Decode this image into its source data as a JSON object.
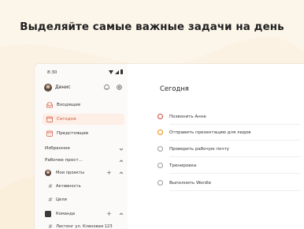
{
  "headline": "Выделяйте самые важные задачи на день",
  "status": {
    "time": "8:30"
  },
  "user": {
    "name": "Денис"
  },
  "nav": {
    "inbox": "Входящие",
    "today": "Сегодня",
    "upcoming": "Предстоящее"
  },
  "sections": {
    "favorites": "Избранное",
    "workspace": "Рабочее прост..."
  },
  "projects": {
    "my_projects": "Мои проекты",
    "activity": "Активность",
    "goals": "Цели",
    "team": "Команда",
    "list_partial": "Листинг ул. Кленовая 123"
  },
  "main": {
    "title": "Сегодня",
    "tasks": [
      {
        "label": "Позвонить Анне",
        "priority": "p1"
      },
      {
        "label": "Отправить презентацию для лидов",
        "priority": "p2"
      },
      {
        "label": "Проверить рабочую почту",
        "priority": "none"
      },
      {
        "label": "Тренировка",
        "priority": "none"
      },
      {
        "label": "Выполнить Wordle",
        "priority": "none"
      }
    ]
  },
  "colors": {
    "accent": "#d4563c",
    "background": "#fbf2e3",
    "priority1": "#d1453b",
    "priority2": "#eb8909"
  }
}
